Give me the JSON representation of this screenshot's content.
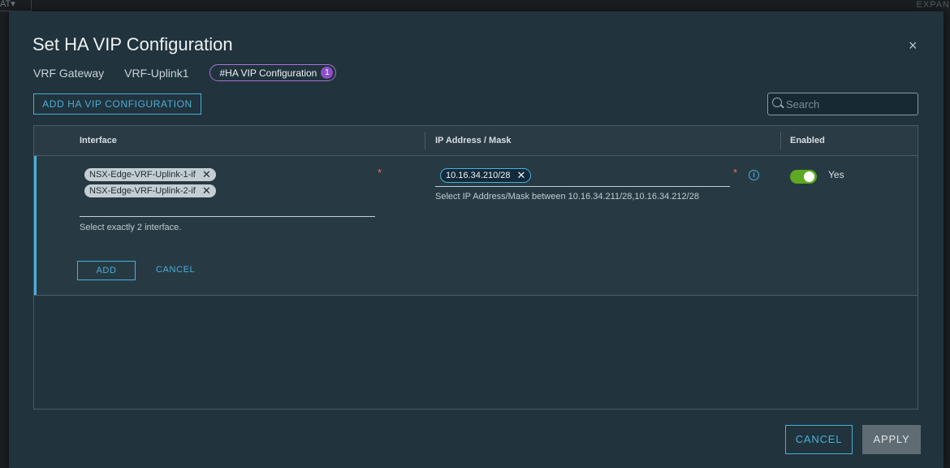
{
  "background": {
    "top_left_text": "AT",
    "top_right_text": "EXPAN"
  },
  "modal": {
    "title": "Set HA VIP Configuration",
    "close_glyph": "×"
  },
  "breadcrumb": {
    "items": [
      "VRF Gateway",
      "VRF-Uplink1"
    ],
    "active": {
      "label": "#HA VIP Configuration",
      "count": "1"
    }
  },
  "toolbar": {
    "add_label": "ADD HA VIP CONFIGURATION",
    "search_placeholder": "Search"
  },
  "grid": {
    "columns": [
      "Interface",
      "IP Address / Mask",
      "Enabled"
    ],
    "edit_row": {
      "interfaces": [
        "NSX-Edge-VRF-Uplink-1-if",
        "NSX-Edge-VRF-Uplink-2-if"
      ],
      "interface_hint": "Select exactly 2 interface.",
      "ip_address": "10.16.34.210/28",
      "ip_hint": "Select IP Address/Mask between 10.16.34.211/28,10.16.34.212/28",
      "required_marker": "*",
      "enabled": true,
      "enabled_label": "Yes",
      "add_label": "ADD",
      "cancel_label": "CANCEL"
    }
  },
  "footer": {
    "cancel_label": "CANCEL",
    "apply_label": "APPLY"
  },
  "colors": {
    "accent": "#49afd9",
    "toggle_on": "#5ea822",
    "required": "#e8705a",
    "badge": "#8d4fc8"
  }
}
